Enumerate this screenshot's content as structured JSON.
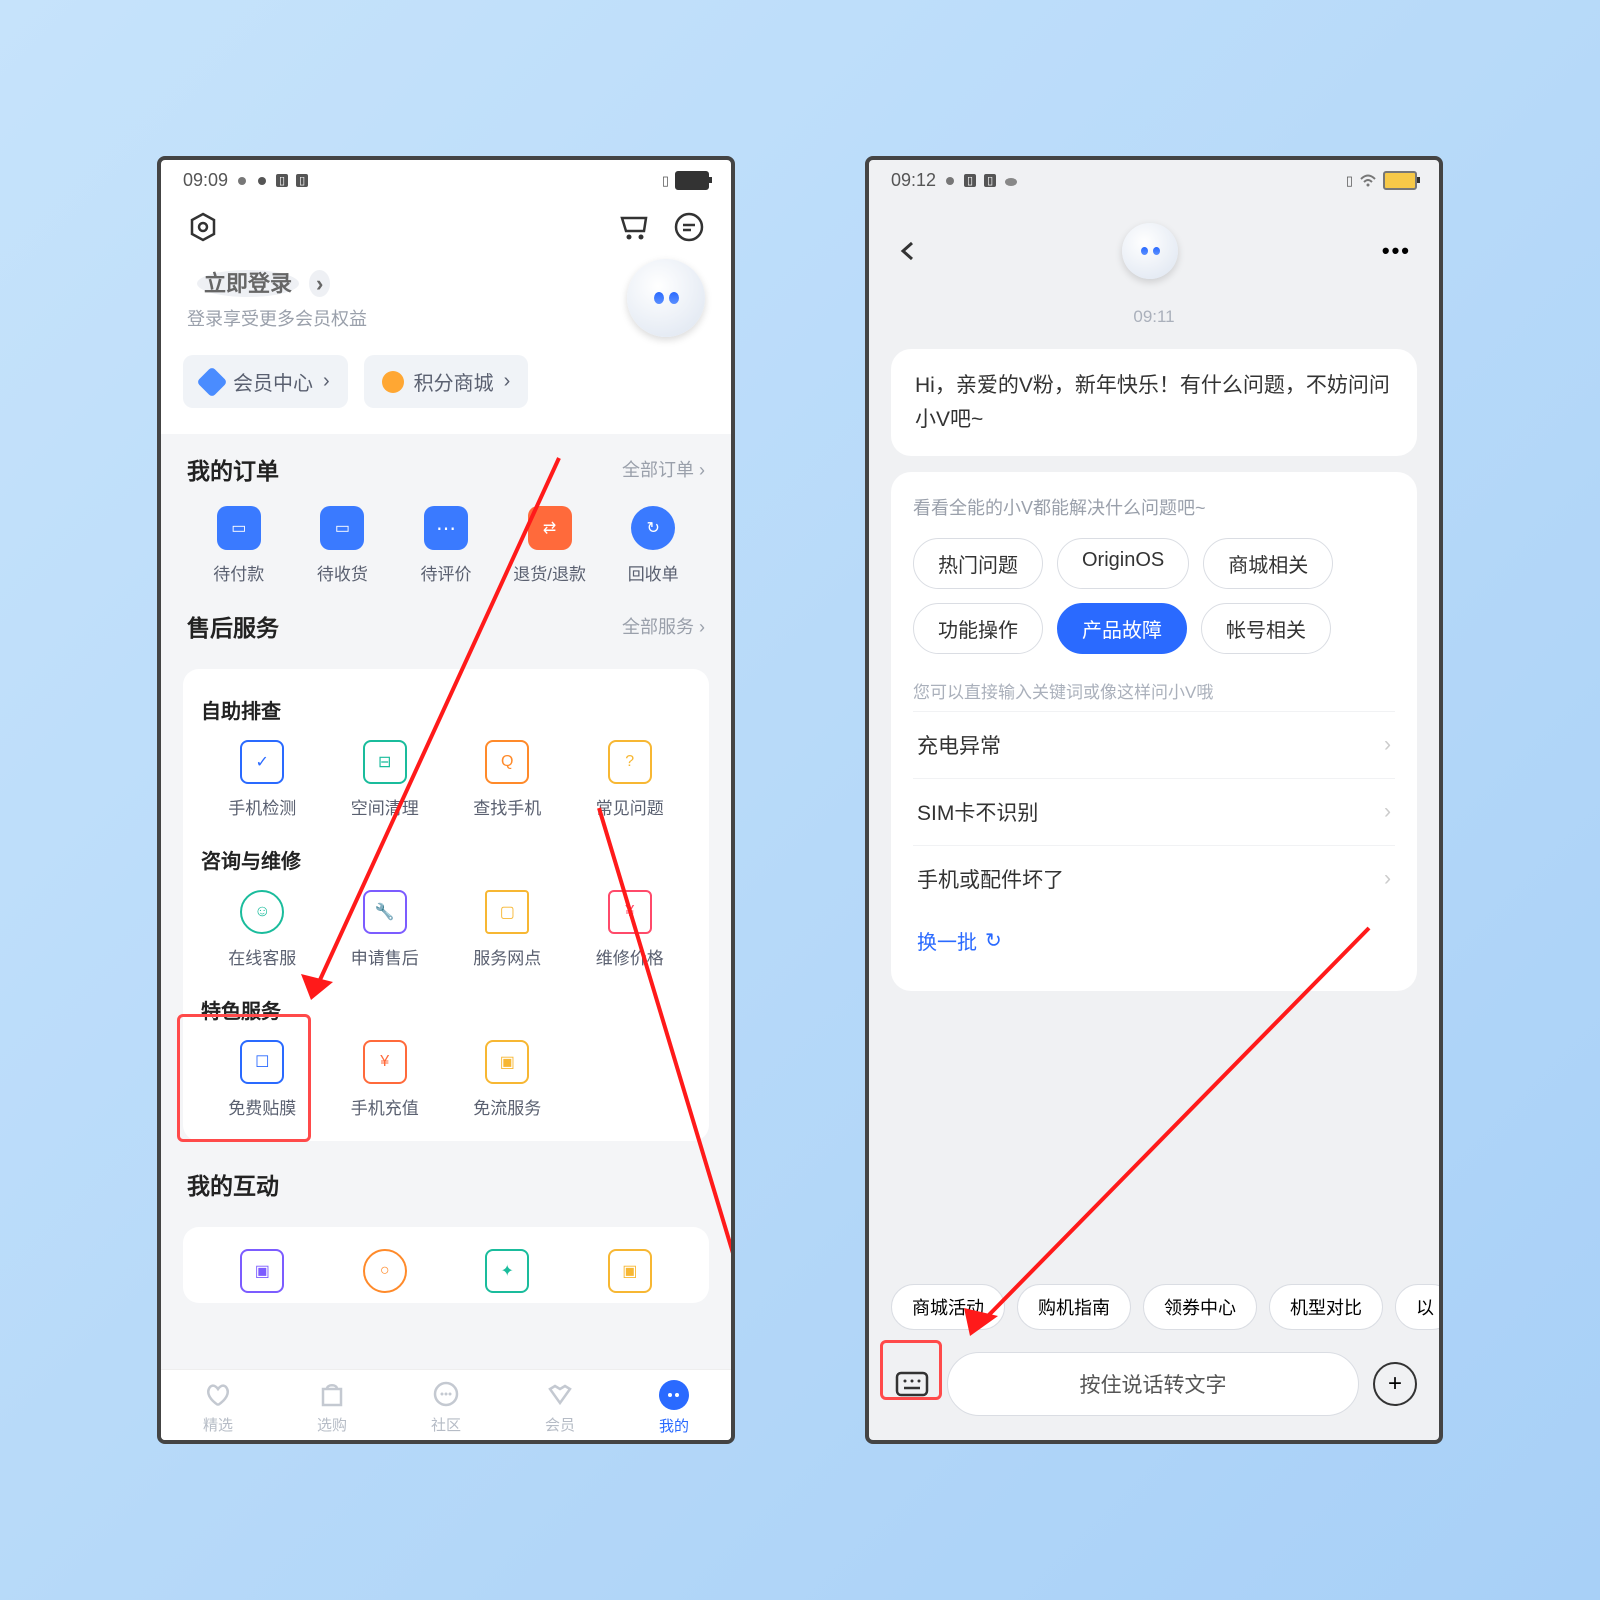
{
  "left": {
    "status": {
      "time": "09:09"
    },
    "login": {
      "title": "立即登录",
      "sub": "登录享受更多会员权益"
    },
    "pills": [
      {
        "label": "会员中心"
      },
      {
        "label": "积分商城"
      }
    ],
    "orders": {
      "title": "我的订单",
      "more": "全部订单 ›",
      "items": [
        "待付款",
        "待收货",
        "待评价",
        "退货/退款",
        "回收单"
      ]
    },
    "service": {
      "title": "售后服务",
      "more": "全部服务 ›",
      "g1": {
        "title": "自助排查",
        "items": [
          "手机检测",
          "空间清理",
          "查找手机",
          "常见问题"
        ]
      },
      "g2": {
        "title": "咨询与维修",
        "items": [
          "在线客服",
          "申请售后",
          "服务网点",
          "维修价格"
        ]
      },
      "g3": {
        "title": "特色服务",
        "items": [
          "免费贴膜",
          "手机充值",
          "免流服务"
        ]
      }
    },
    "inter": "我的互动",
    "nav": [
      "精选",
      "选购",
      "社区",
      "会员",
      "我的"
    ]
  },
  "right": {
    "status": {
      "time": "09:12"
    },
    "ts": "09:11",
    "greet": "Hi，亲爱的V粉，新年快乐！有什么问题，不妨问问小V吧~",
    "card": {
      "head": "看看全能的小V都能解决什么问题吧~",
      "chips": [
        "热门问题",
        "OriginOS",
        "商城相关",
        "功能操作",
        "产品故障",
        "帐号相关"
      ],
      "active": 4,
      "hint": "您可以直接输入关键词或像这样问小V哦",
      "q": [
        "充电异常",
        "SIM卡不识别",
        "手机或配件坏了"
      ],
      "swap": "换一批"
    },
    "quick": [
      "商城活动",
      "购机指南",
      "领券中心",
      "机型对比",
      "以"
    ],
    "input": "按住说话转文字"
  }
}
